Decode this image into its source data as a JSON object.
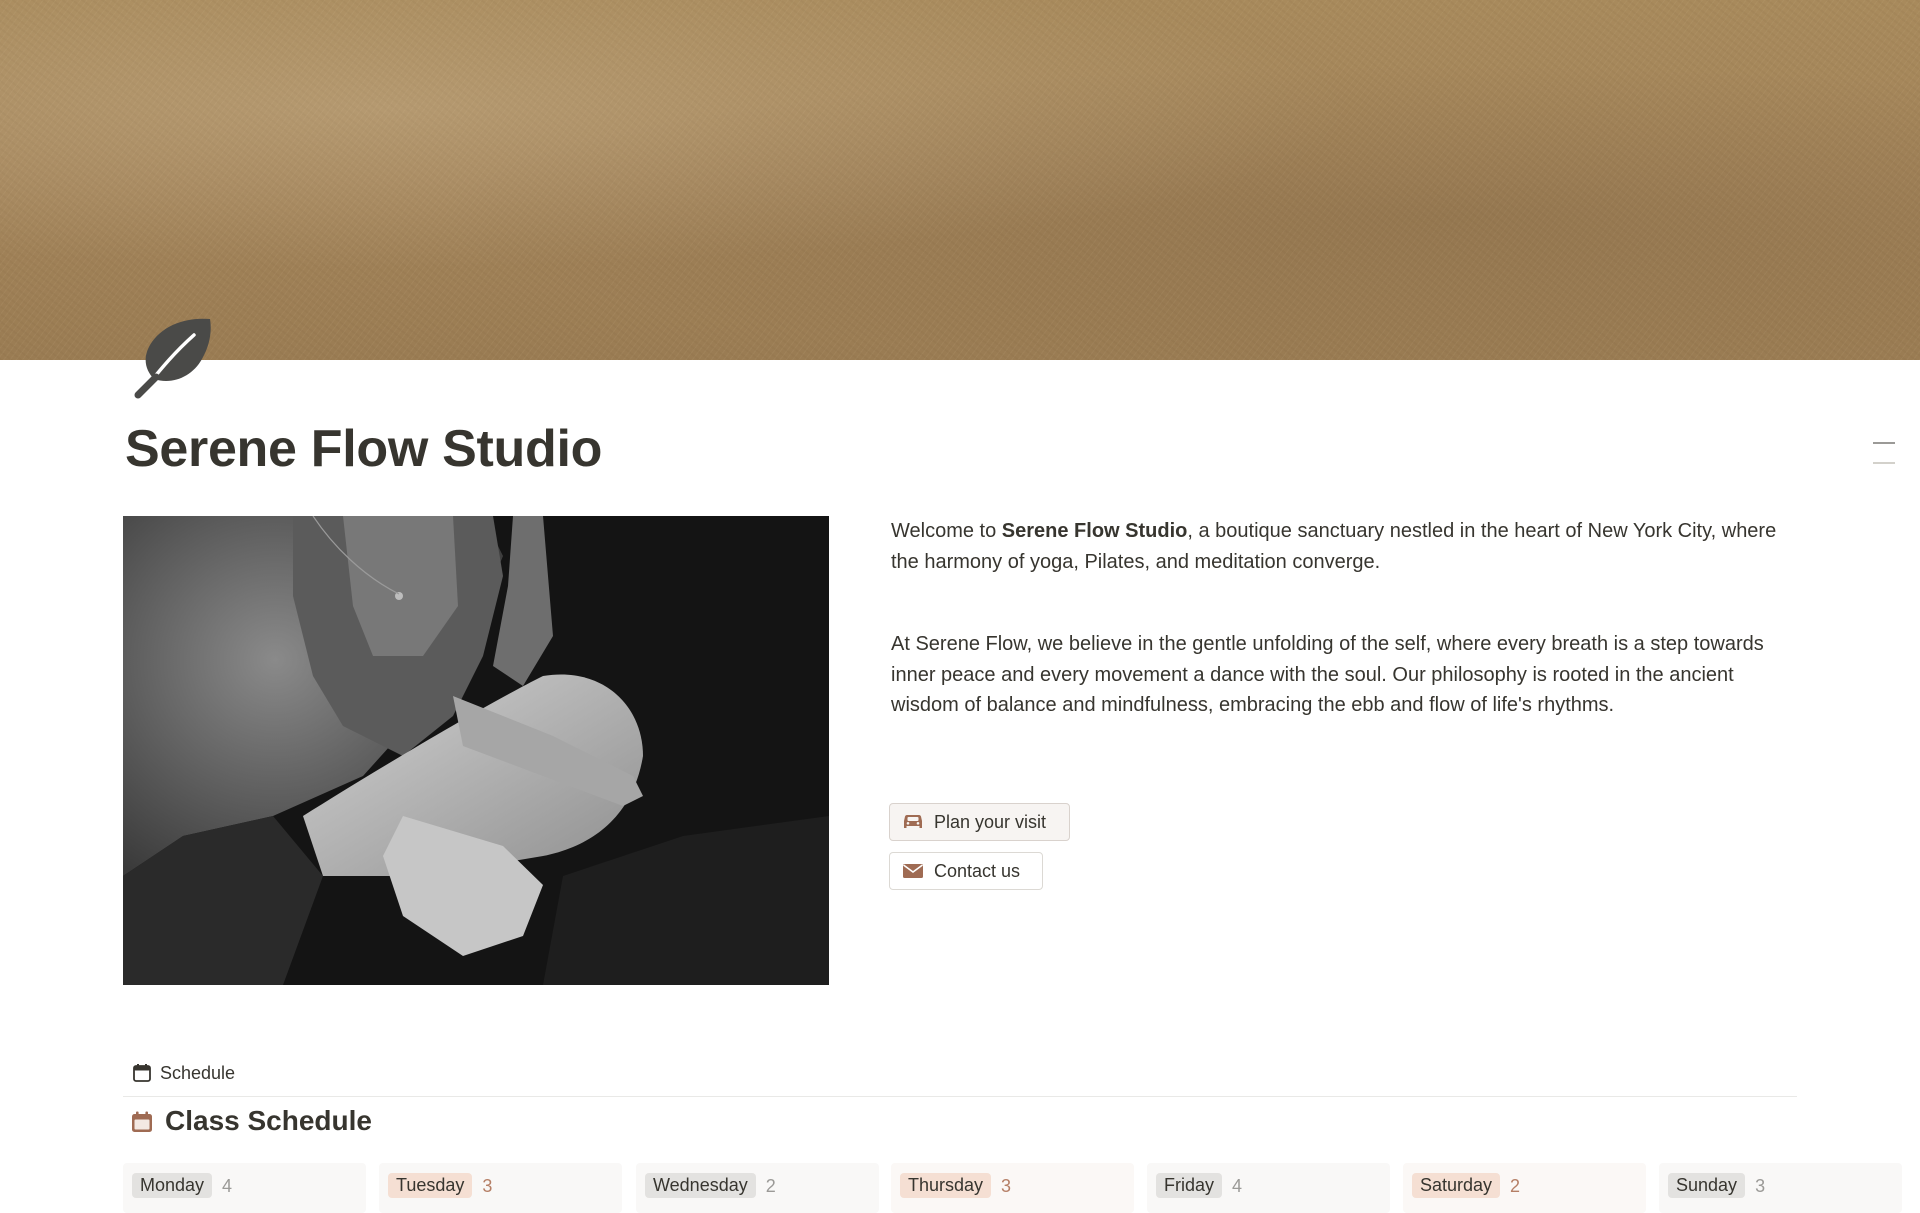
{
  "page": {
    "title": "Serene Flow Studio",
    "icon": "leaf-icon",
    "cover": "kraft-paper-texture",
    "hero_image": "black-and-white-meditation-pose-photo"
  },
  "intro": {
    "p1_before": "Welcome to ",
    "p1_bold": "Serene Flow Studio",
    "p1_after": ", a boutique sanctuary nestled in the heart of New York City, where the harmony of yoga, Pilates, and meditation converge.",
    "p2": "At Serene Flow, we believe in the gentle unfolding of the self, where every breath is a step towards inner peace and every movement a dance with the soul. Our philosophy is rooted in the ancient wisdom of balance and mindfulness, embracing the ebb and flow of life's rhythms."
  },
  "buttons": {
    "plan_visit": {
      "label": "Plan your visit",
      "icon": "car-icon"
    },
    "contact": {
      "label": "Contact us",
      "icon": "envelope-icon"
    }
  },
  "database": {
    "view_tab": {
      "label": "Schedule",
      "icon": "calendar-icon"
    },
    "title": "Class Schedule",
    "title_icon": "calendar-icon",
    "groups": [
      {
        "label": "Monday",
        "count": "4",
        "chip_bg": "#e3e2e0",
        "count_color": "#9b9a97"
      },
      {
        "label": "Tuesday",
        "count": "3",
        "chip_bg": "#f5dfd3",
        "count_color": "#b57f66"
      },
      {
        "label": "Wednesday",
        "count": "2",
        "chip_bg": "#e3e2e0",
        "count_color": "#9b9a97"
      },
      {
        "label": "Thursday",
        "count": "3",
        "chip_bg": "#f5dfd3",
        "count_color": "#b57f66"
      },
      {
        "label": "Friday",
        "count": "4",
        "chip_bg": "#e3e2e0",
        "count_color": "#9b9a97"
      },
      {
        "label": "Saturday",
        "count": "2",
        "chip_bg": "#f5dfd3",
        "count_color": "#b57f66"
      },
      {
        "label": "Sunday",
        "count": "3",
        "chip_bg": "#e3e2e0",
        "count_color": "#9b9a97"
      }
    ]
  },
  "colors": {
    "text": "#37352f",
    "accent_brown": "#9f6b53",
    "cover": "#a3845a"
  }
}
